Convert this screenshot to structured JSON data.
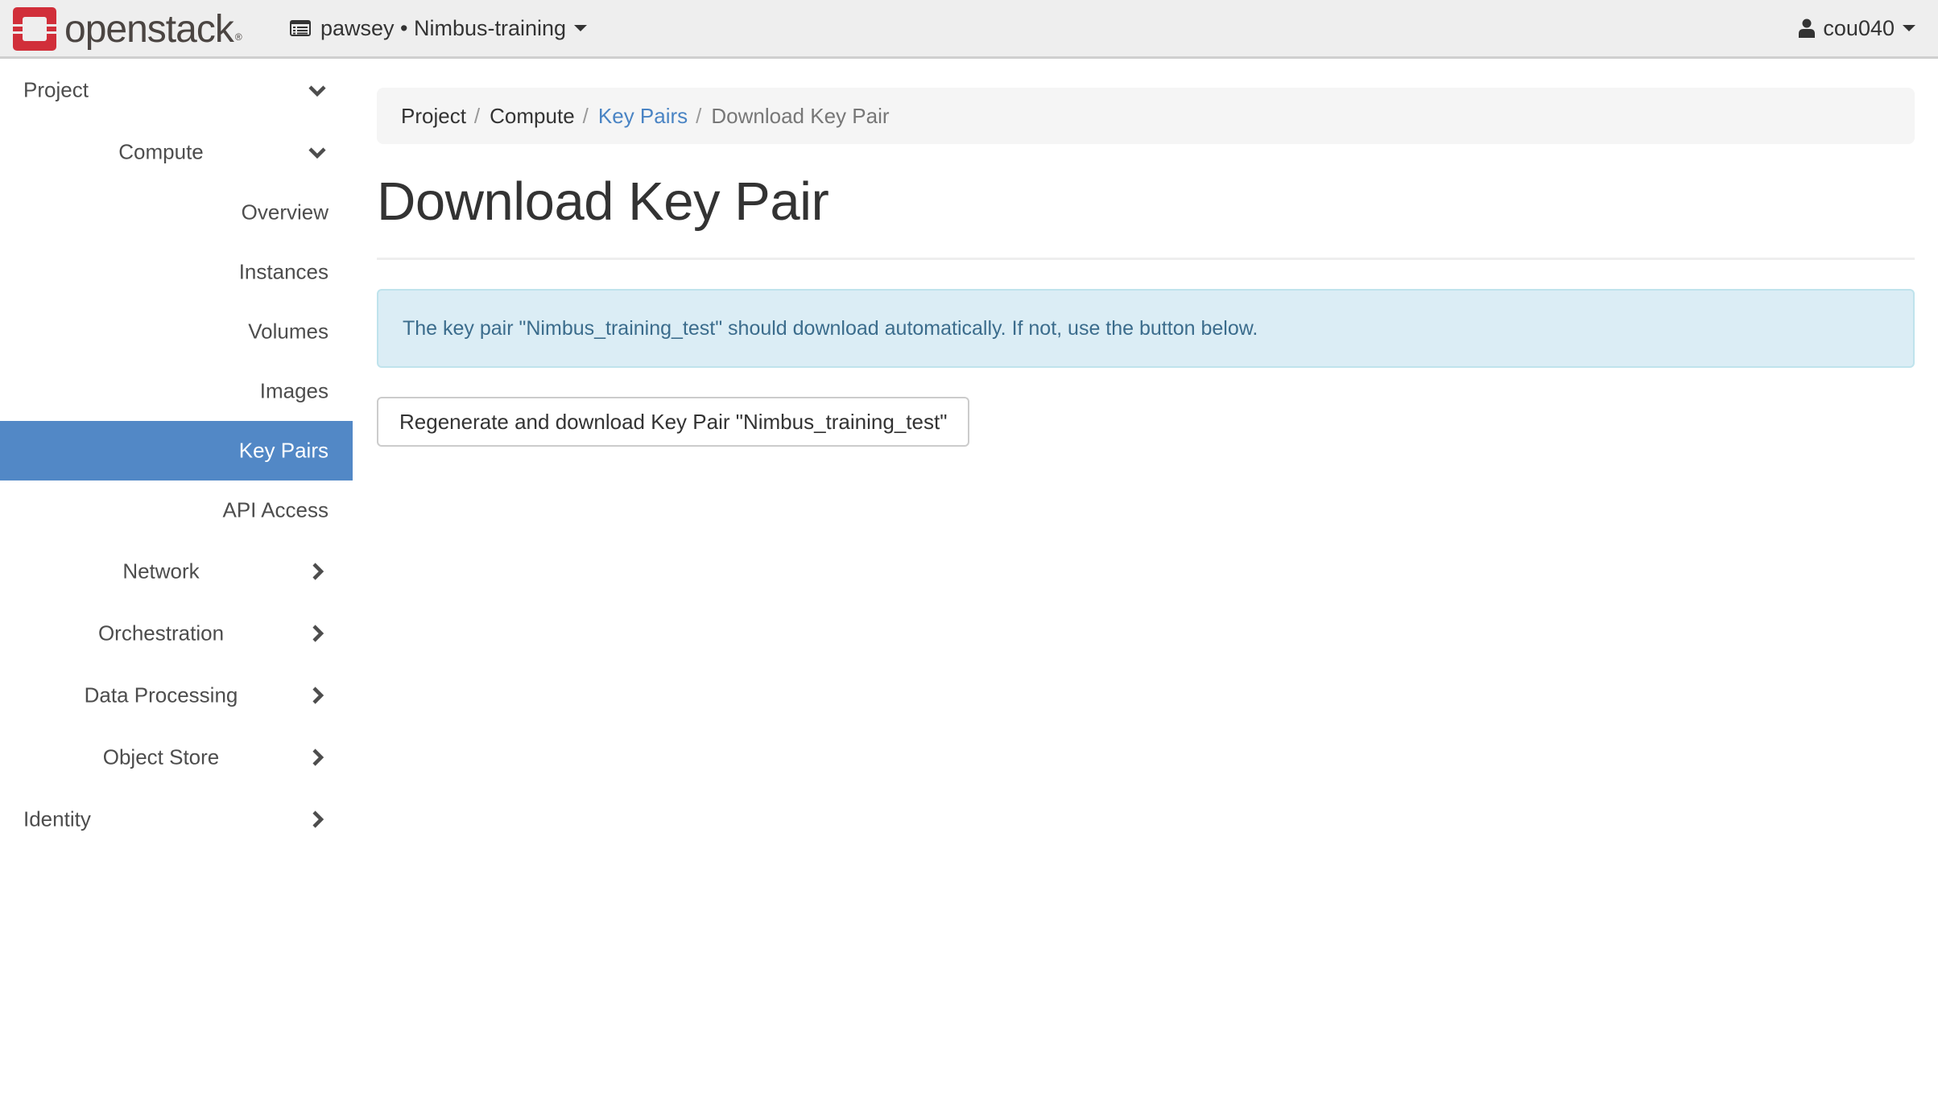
{
  "header": {
    "logo_text": "openstack",
    "logo_reg": "®",
    "project_picker": "pawsey • Nimbus-training",
    "user": "cou040",
    "colors": {
      "logo_red": "#d12f3a",
      "bar_bg": "#eeeeee"
    }
  },
  "sidebar": {
    "project": "Project",
    "compute": "Compute",
    "compute_items": [
      {
        "label": "Overview",
        "active": false
      },
      {
        "label": "Instances",
        "active": false
      },
      {
        "label": "Volumes",
        "active": false
      },
      {
        "label": "Images",
        "active": false
      },
      {
        "label": "Key Pairs",
        "active": true
      },
      {
        "label": "API Access",
        "active": false
      }
    ],
    "network": "Network",
    "orchestration": "Orchestration",
    "data_processing": "Data Processing",
    "object_store": "Object Store",
    "identity": "Identity",
    "active_color": "#5288c6"
  },
  "breadcrumb": {
    "items": [
      "Project",
      "Compute",
      "Key Pairs",
      "Download Key Pair"
    ],
    "separator": "/"
  },
  "main": {
    "title": "Download Key Pair",
    "alert": "The key pair \"Nimbus_training_test\" should download automatically. If not, use the button below.",
    "button": "Regenerate and download Key Pair \"Nimbus_training_test\""
  }
}
